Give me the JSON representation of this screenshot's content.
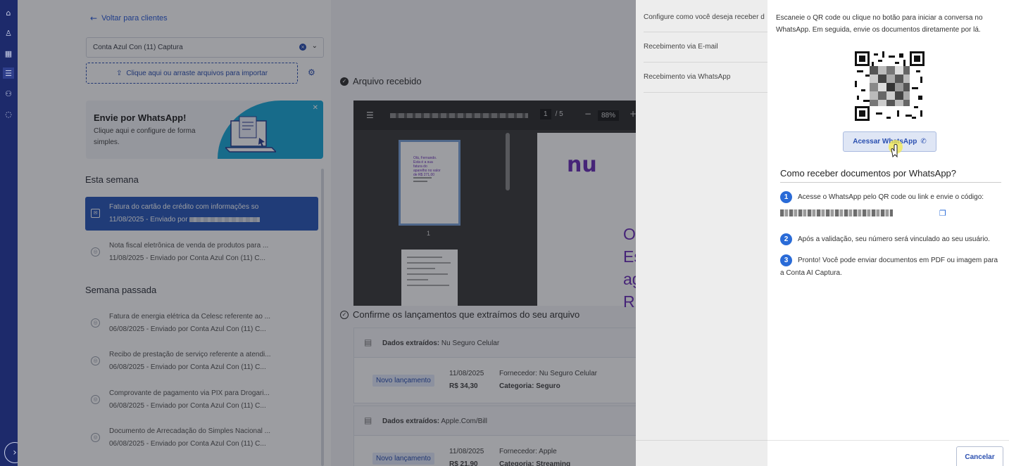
{
  "nav": {
    "back_label": "Voltar para clientes"
  },
  "client_select": {
    "value": "Conta Azul Con (11) Captura"
  },
  "upload": {
    "label": "Clique aqui ou arraste arquivos para importar"
  },
  "promo": {
    "title": "Envie por WhatsApp!",
    "description": "Clique aqui e configure de forma simples."
  },
  "sections": {
    "this_week": "Esta semana",
    "last_week": "Semana passada"
  },
  "documents": [
    {
      "title": "Fatura do cartão de crédito com informações so",
      "meta": "11/08/2025 - Enviado por"
    },
    {
      "title": "Nota fiscal eletrônica de venda de produtos para ...",
      "meta": "11/08/2025 - Enviado por Conta Azul Con (11) C..."
    },
    {
      "title": "Fatura de energia elétrica da Celesc referente ao ...",
      "meta": "06/08/2025 - Enviado por Conta Azul Con (11) C..."
    },
    {
      "title": "Recibo de prestação de serviço referente a atendi...",
      "meta": "06/08/2025 - Enviado por Conta Azul Con (11) C..."
    },
    {
      "title": "Comprovante de pagamento via PIX para Drogari...",
      "meta": "06/08/2025 - Enviado por Conta Azul Con (11) C..."
    },
    {
      "title": "Documento de Arrecadação do Simples Nacional ...",
      "meta": "06/08/2025 - Enviado por Conta Azul Con (11) C..."
    }
  ],
  "viewer": {
    "heading": "Arquivo recebido",
    "page_current": "1",
    "page_total": "/ 5",
    "zoom": "88%",
    "thumb_label": "1",
    "brand": "nu",
    "thumb_text": "Olá, Fernando. Esta é a sua fatura do aparelho no valor de R$ 271,00",
    "page_text": [
      "O",
      "Es",
      "ag",
      "R"
    ]
  },
  "confirm": {
    "heading": "Confirme os lançamentos que extraímos do seu arquivo",
    "extracted_label": "Dados extraídos:",
    "entries": [
      {
        "source": "Nu Seguro Celular",
        "badge": "Novo lançamento",
        "date": "11/08/2025",
        "amount": "R$ 34,30",
        "supplier": "Fornecedor: Nu Seguro Celular",
        "category": "Categoria: Seguro"
      },
      {
        "source": "Apple.Com/Bill",
        "badge": "Novo lançamento",
        "date": "11/08/2025",
        "amount": "R$ 21,90",
        "supplier": "Fornecedor: Apple",
        "category": "Categoria: Streaming"
      }
    ]
  },
  "settings_menu": {
    "intro": "Configure como você deseja receber d",
    "items": [
      "Recebimento via E-mail",
      "Recebimento via WhatsApp"
    ]
  },
  "whatsapp_panel": {
    "intro": "Escaneie o QR code ou clique no botão para iniciar a conversa no WhatsApp. Em seguida, envie os documentos diretamente por lá.",
    "button": "Acessar WhatsApp",
    "how_title": "Como receber documentos por WhatsApp?",
    "steps": [
      {
        "n": "1",
        "text": "Acesse o WhatsApp pelo QR code ou link e envie o código:"
      },
      {
        "n": "2",
        "text": "Após a validação, seu número será vinculado ao seu usuário."
      },
      {
        "n": "3",
        "text": "Pronto! Você pode enviar documentos em PDF ou imagem para a Conta AI Captura."
      }
    ],
    "cancel": "Cancelar"
  },
  "colors": {
    "rail": "#1d2a6b",
    "accent": "#2a4fb0",
    "selected_doc": "#2a59b8",
    "step_badge": "#2a6bd7",
    "brand_purple": "#6b2fb8"
  }
}
